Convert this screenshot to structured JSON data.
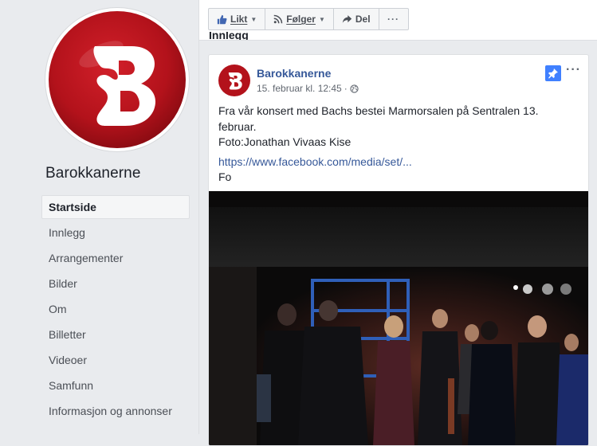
{
  "page": {
    "name": "Barokkanerne",
    "profile_letter": "B"
  },
  "sidebar": {
    "items": [
      {
        "label": "Startside",
        "active": true
      },
      {
        "label": "Innlegg"
      },
      {
        "label": "Arrangementer"
      },
      {
        "label": "Bilder"
      },
      {
        "label": "Om"
      },
      {
        "label": "Billetter"
      },
      {
        "label": "Videoer"
      },
      {
        "label": "Samfunn"
      },
      {
        "label": "Informasjon og annonser"
      }
    ]
  },
  "action_bar": {
    "like_label": "Likt",
    "follow_label": "Følger",
    "share_label": "Del",
    "more_label": "···"
  },
  "section": {
    "heading": "Innlegg"
  },
  "post": {
    "author": "Barokkanerne",
    "timestamp": "15. februar kl. 12:45",
    "meta_separator": "·",
    "text_line1": "Fra vår konsert med Bachs bestei Marmorsalen på Sentralen 13. februar.",
    "text_line2": "Foto:Jonathan Vivaas Kise",
    "link": "https://www.facebook.com/media/set/...",
    "text_line3": "Fo",
    "menu_label": "···",
    "image_description_icon": "concert-photo"
  },
  "icons": {
    "like": "thumbs-up-icon",
    "follow": "rss-icon",
    "share": "share-arrow-icon",
    "pin": "pin-icon",
    "audience": "globe-icon"
  },
  "colors": {
    "brand_red": "#b3121b",
    "link_blue": "#365899",
    "pin_blue": "#4080ff",
    "background": "#e9ebee"
  }
}
